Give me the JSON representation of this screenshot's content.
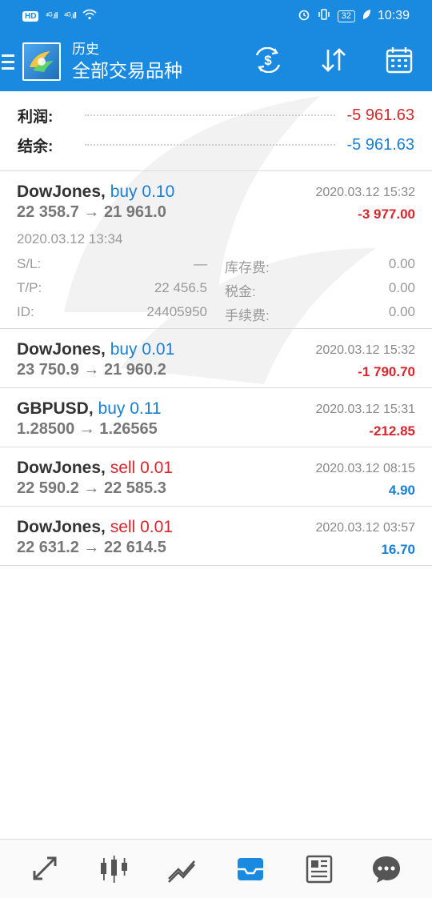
{
  "status_bar": {
    "hd": "HD",
    "sig1": "⁴ᴳ.ıll",
    "sig2": "⁴ᴳ.ıll",
    "battery": "32",
    "time": "10:39"
  },
  "header": {
    "title_small": "历史",
    "title_big": "全部交易品种"
  },
  "summary": {
    "profit_label": "利润:",
    "profit_value": "-5 961.63",
    "balance_label": "结余:",
    "balance_value": "-5 961.63"
  },
  "trades": [
    {
      "symbol": "DowJones,",
      "side": "buy",
      "volume": "0.10",
      "prices": "22 358.7 → 21 961.0",
      "date": "2020.03.12 15:32",
      "profit": "-3 977.00",
      "expanded": {
        "open_time": "2020.03.12 13:34",
        "sl_label": "S/L:",
        "sl_value": "—",
        "tp_label": "T/P:",
        "tp_value": "22 456.5",
        "id_label": "ID:",
        "id_value": "24405950",
        "swap_label": "库存费:",
        "swap_value": "0.00",
        "tax_label": "税金:",
        "tax_value": "0.00",
        "commission_label": "手续费:",
        "commission_value": "0.00"
      }
    },
    {
      "symbol": "DowJones,",
      "side": "buy",
      "volume": "0.01",
      "prices": "23 750.9 → 21 960.2",
      "date": "2020.03.12 15:32",
      "profit": "-1 790.70"
    },
    {
      "symbol": "GBPUSD,",
      "side": "buy",
      "volume": "0.11",
      "prices": "1.28500 → 1.26565",
      "date": "2020.03.12 15:31",
      "profit": "-212.85"
    },
    {
      "symbol": "DowJones,",
      "side": "sell",
      "volume": "0.01",
      "prices": "22 590.2 → 22 585.3",
      "date": "2020.03.12 08:15",
      "profit": "4.90"
    },
    {
      "symbol": "DowJones,",
      "side": "sell",
      "volume": "0.01",
      "prices": "22 631.2 → 22 614.5",
      "date": "2020.03.12 03:57",
      "profit": "16.70"
    }
  ],
  "nav_icons": [
    "quotes-icon",
    "chart-icon",
    "trade-icon",
    "history-icon",
    "news-icon",
    "chat-icon"
  ],
  "colors": {
    "accent": "#1a8ae0",
    "negative": "#d9262c",
    "positive": "#1a7fd4"
  }
}
